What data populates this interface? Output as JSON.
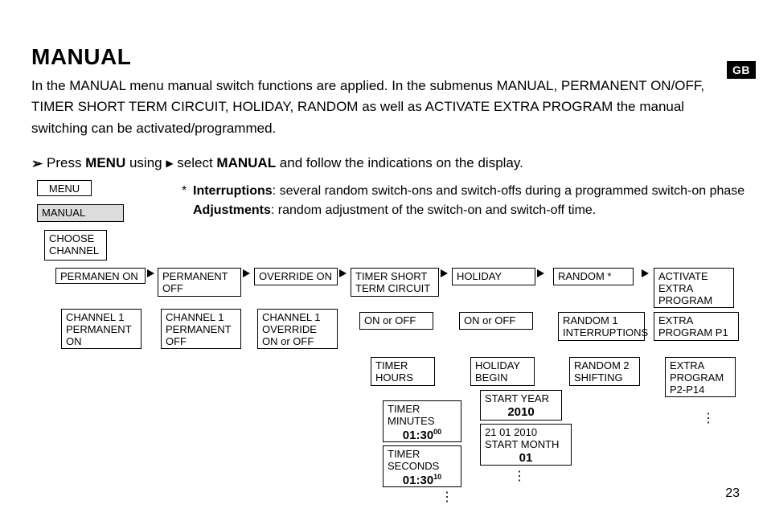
{
  "header": {
    "title": "MANUAL",
    "badge": "GB",
    "intro_html": "In the MANUAL menu manual switch functions are applied. In the submenus MANUAL, PERMANENT ON/OFF, TIMER SHORT TERM CIRCUIT, HOLIDAY, RANDOM as well as ACTIVATE EXTRA PROGRAM the manual switching can be activated/programmed."
  },
  "instruction": {
    "pre": "Press ",
    "menu": "MENU",
    "mid": " using ",
    "post": " select ",
    "manual": "MANUAL",
    "tail": " and follow the indications on the display."
  },
  "notes": {
    "interruptions_label": "Interruptions",
    "interruptions_text": ": several random switch-ons and switch-offs during a programmed switch-on phase",
    "adjustments_label": "Adjustments",
    "adjustments_text": ": random adjustment of the switch-on and switch-off time."
  },
  "boxes": {
    "menu": "MENU",
    "manual": "MANUAL",
    "choose_channel": "CHOOSE CHANNEL",
    "permanen_on": "PERMANEN ON",
    "ch1_perm_on": "CHANNEL 1 PERMANENT ON",
    "permanent_off": "PERMANENT OFF",
    "ch1_perm_off": "CHANNEL 1 PERMANENT OFF",
    "override_on": "OVERRIDE ON",
    "ch1_override": "CHANNEL 1 OVERRIDE ON or OFF",
    "timer_short": "TIMER SHORT TERM CIRCUIT",
    "on_off1": "ON or OFF",
    "timer_hours": "TIMER HOURS",
    "timer_minutes": "TIMER MINUTES",
    "timer_minutes_val": "01:30",
    "timer_minutes_sup": "00",
    "timer_seconds": "TIMER SECONDS",
    "timer_seconds_val": "01:30",
    "timer_seconds_sup": "10",
    "holiday": "HOLIDAY",
    "on_off2": "ON or OFF",
    "holiday_begin": "HOLIDAY BEGIN",
    "start_year": "START YEAR",
    "start_year_val": "2010",
    "start_month_date": "21  01  2010",
    "start_month": "START MONTH",
    "start_month_val": "01",
    "random": "RANDOM *",
    "random1": "RANDOM 1 INTERRUPTIONS",
    "random2": "RANDOM 2 SHIFTING",
    "activate": "ACTIVATE EXTRA PROGRAM",
    "extra_p1": "EXTRA PROGRAM P1",
    "extra_p2": "EXTRA PROGRAM P2-P14"
  },
  "page_number": "23"
}
